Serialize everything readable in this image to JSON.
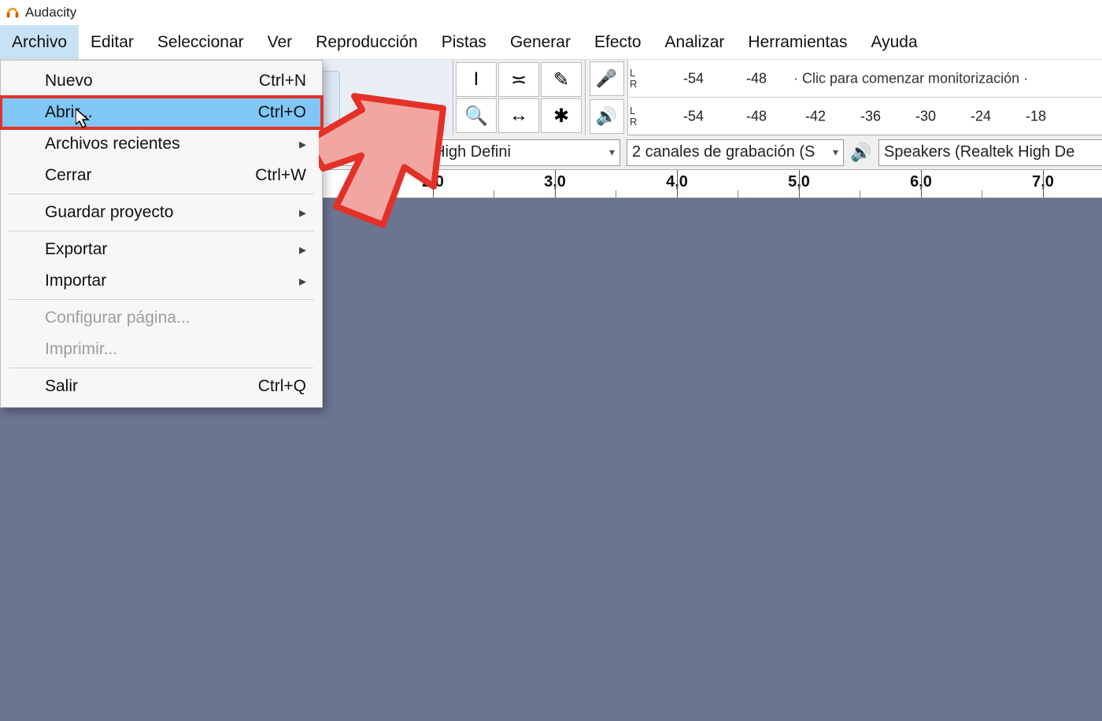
{
  "app": {
    "title": "Audacity"
  },
  "menubar": {
    "items": [
      "Archivo",
      "Editar",
      "Seleccionar",
      "Ver",
      "Reproducción",
      "Pistas",
      "Generar",
      "Efecto",
      "Analizar",
      "Herramientas",
      "Ayuda"
    ],
    "open_index": 0
  },
  "file_menu": {
    "nuevo": {
      "label": "Nuevo",
      "shortcut": "Ctrl+N"
    },
    "abrir": {
      "label": "Abrir...",
      "shortcut": "Ctrl+O"
    },
    "recientes": {
      "label": "Archivos recientes"
    },
    "cerrar": {
      "label": "Cerrar",
      "shortcut": "Ctrl+W"
    },
    "guardar": {
      "label": "Guardar proyecto"
    },
    "exportar": {
      "label": "Exportar"
    },
    "importar": {
      "label": "Importar"
    },
    "config_pagina": {
      "label": "Configurar página..."
    },
    "imprimir": {
      "label": "Imprimir..."
    },
    "salir": {
      "label": "Salir",
      "shortcut": "Ctrl+Q"
    }
  },
  "tools": {
    "selection": "I",
    "envelope": "≍",
    "draw": "✎",
    "zoom": "🔍",
    "timeshift": "↔",
    "multi": "✱"
  },
  "meters": {
    "rec_hint": "Clic para comenzar monitorización",
    "db_top": [
      "-54",
      "-48"
    ],
    "db_bot": [
      "-54",
      "-48",
      "-42",
      "-36",
      "-30",
      "-24",
      "-18"
    ]
  },
  "devices": {
    "input": "hone (Realtek High Defini",
    "channels": "2 canales de grabación (S",
    "output": "Speakers (Realtek High De"
  },
  "ruler": {
    "labels": [
      "2,0",
      "3,0",
      "4,0",
      "5,0",
      "6,0",
      "7,0"
    ]
  }
}
